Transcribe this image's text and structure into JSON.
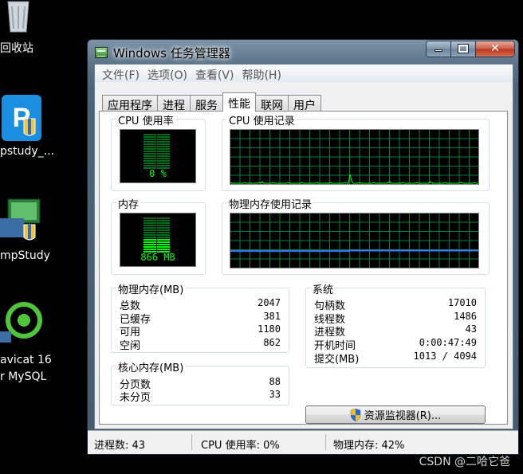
{
  "desktop": {
    "icons": [
      {
        "label": "回收站"
      },
      {
        "label": "pstudy_..."
      },
      {
        "label": "mpStudy"
      },
      {
        "label_line1": "avicat 16",
        "label_line2": "r MySQL"
      }
    ]
  },
  "window": {
    "title": "Windows 任务管理器",
    "controls": {
      "close_glyph": "✕"
    }
  },
  "menu": [
    "文件(F)",
    "选项(O)",
    "查看(V)",
    "帮助(H)"
  ],
  "tabs": [
    {
      "label": "应用程序",
      "active": false
    },
    {
      "label": "进程",
      "active": false
    },
    {
      "label": "服务",
      "active": false
    },
    {
      "label": "性能",
      "active": true
    },
    {
      "label": "联网",
      "active": false
    },
    {
      "label": "用户",
      "active": false
    }
  ],
  "performance": {
    "cpu_usage": {
      "title": "CPU 使用率",
      "value": "0 %",
      "level": 0.0
    },
    "cpu_history": {
      "title": "CPU 使用记录"
    },
    "memory": {
      "title": "内存",
      "value": "866 MB",
      "level": 0.42
    },
    "memory_history": {
      "title": "物理内存使用记录"
    },
    "physical_memory": {
      "title": "物理内存(MB)",
      "rows": [
        {
          "label": "总数",
          "value": "2047"
        },
        {
          "label": "已缓存",
          "value": "381"
        },
        {
          "label": "可用",
          "value": "1180"
        },
        {
          "label": "空闲",
          "value": "862"
        }
      ]
    },
    "kernel_memory": {
      "title": "核心内存(MB)",
      "rows": [
        {
          "label": "分页数",
          "value": "88"
        },
        {
          "label": "未分页",
          "value": "33"
        }
      ]
    },
    "system": {
      "title": "系统",
      "rows": [
        {
          "label": "句柄数",
          "value": "17010"
        },
        {
          "label": "线程数",
          "value": "1486"
        },
        {
          "label": "进程数",
          "value": "43"
        },
        {
          "label": "开机时间",
          "value": "0:00:47:49"
        },
        {
          "label": "提交(MB)",
          "value": "1013 / 4094"
        }
      ]
    },
    "resource_monitor_button": "资源监视器(R)..."
  },
  "statusbar": {
    "processes": "进程数: 43",
    "cpu": "CPU 使用率: 0%",
    "memory": "物理内存: 42%"
  },
  "watermark": "CSDN @二哈它爸",
  "colors": {
    "graph_grid": "#008040",
    "cpu_line": "#00ff00",
    "mem_line": "#3a7dff",
    "meter_text": "#00ff00"
  }
}
